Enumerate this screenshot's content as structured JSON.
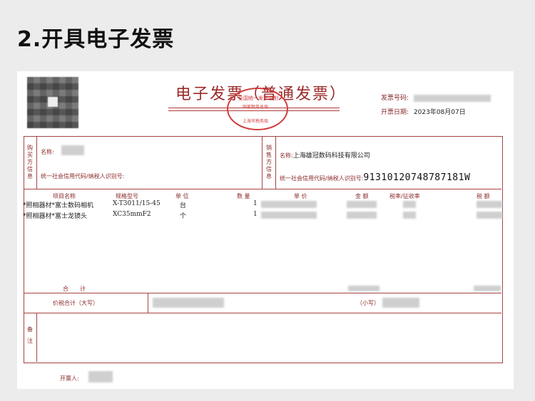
{
  "page": {
    "heading": "2.开具电子发票"
  },
  "invoice": {
    "title": "电子发票（普通发票）",
    "seal": {
      "top": "全国统一发票监制",
      "mid": "国家税务总局",
      "bottom": "上海市税务局"
    },
    "number_label": "发票号码:",
    "date_label": "开票日期:",
    "date_value": "2023年08月07日",
    "buyer": {
      "side_label": "购买方信息",
      "name_label": "名称:",
      "taxid_label": "统一社会信用代码/纳税人识别号:"
    },
    "seller": {
      "side_label": "销售方信息",
      "name_label": "名称:",
      "name_value": "上海雄冠数码科技有限公司",
      "taxid_label": "统一社会信用代码/纳税人识别号:",
      "taxid_value": "91310120748787181W"
    },
    "columns": {
      "item": "项目名称",
      "spec": "规格型号",
      "unit": "单 位",
      "qty": "数 量",
      "price": "单 价",
      "amount": "金 额",
      "rate": "税率/征收率",
      "tax": "税 额"
    },
    "items": [
      {
        "name": "*照相器材*富士数码相机",
        "spec": "X-T3011/15-45",
        "unit": "台",
        "qty": "1"
      },
      {
        "name": "*照相器材*富士龙镜头",
        "spec": "XC35mmF2",
        "unit": "个",
        "qty": "1"
      }
    ],
    "total_label": "合　　计",
    "total_words_label": "价税合计（大写）",
    "total_small_label": "（小写）",
    "remarks_label": "备注",
    "issuer_label": "开票人:"
  }
}
